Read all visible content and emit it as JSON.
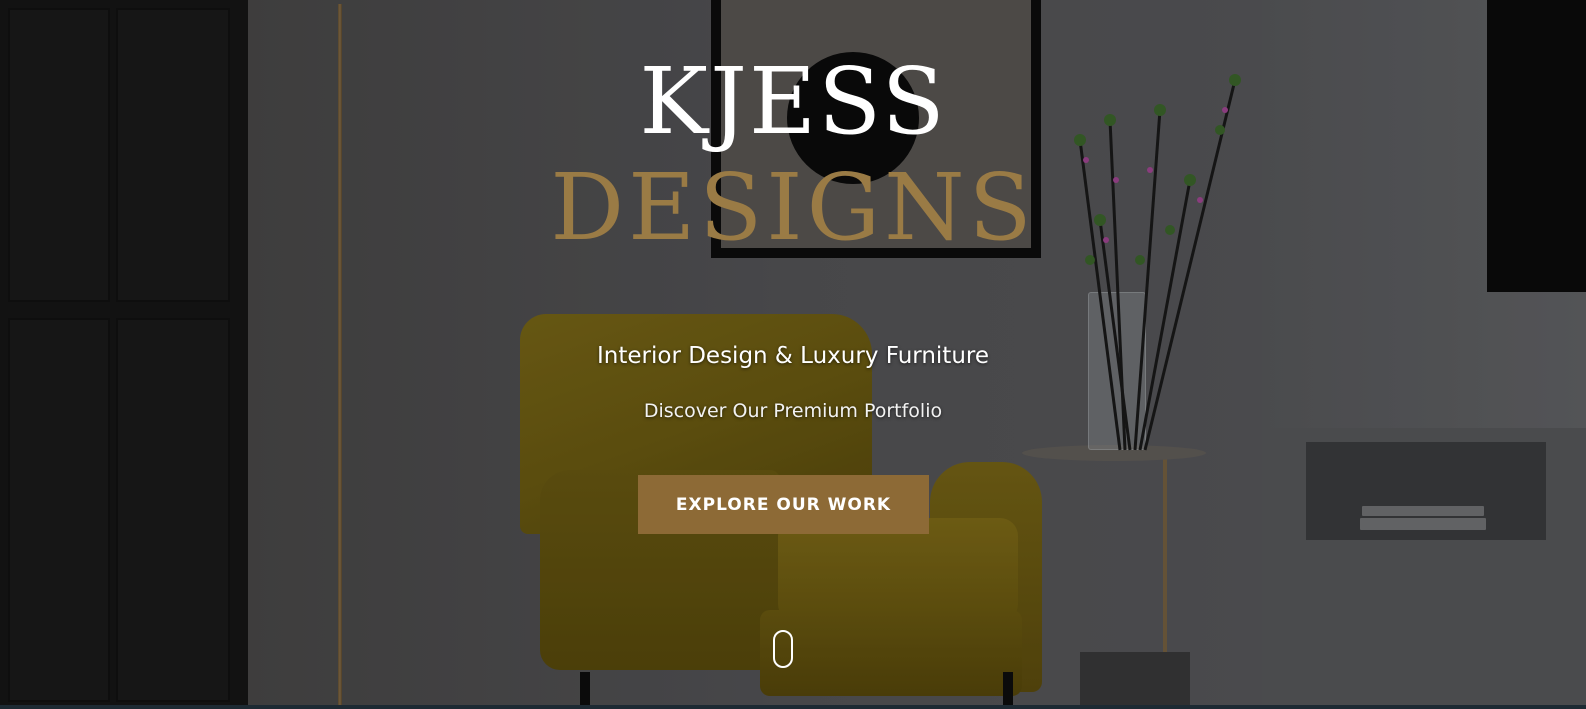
{
  "brand": {
    "name_top": "KJESS",
    "name_bottom": "DESIGNS"
  },
  "hero": {
    "tagline": "Interior Design & Luxury Furniture",
    "subtagline": "Discover Our Premium Portfolio",
    "cta_label": "EXPLORE OUR WORK"
  },
  "colors": {
    "accent_gold": "#8d6a36",
    "logo_gold": "#9a7b45",
    "text_white": "#ffffff"
  },
  "icons": {
    "scroll": "mouse-scroll-icon"
  }
}
